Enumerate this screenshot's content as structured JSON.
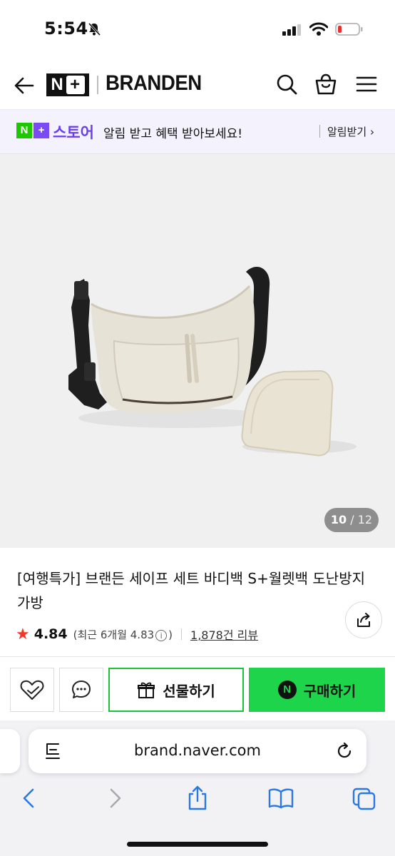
{
  "status_bar": {
    "time": "5:54"
  },
  "header": {
    "logo_text": "N+",
    "brand": "BRANDEN",
    "icons": [
      "back-arrow-icon",
      "search-icon",
      "shopping-bag-icon",
      "menu-icon"
    ]
  },
  "banner": {
    "logo_n": "N",
    "logo_plus": "+",
    "store_label": "스토어",
    "message": "알림 받고 혜택 받아보세요!",
    "action": "알림받기 ›"
  },
  "gallery": {
    "current": "10",
    "separator": "/",
    "total": "12"
  },
  "product": {
    "title": "[여행특가] 브랜든 세이프 세트 바디백 S+월렛백 도난방지 가방",
    "rating": "4.84",
    "recent_prefix": "(최근 6개월 4.83",
    "recent_suffix": ")",
    "info_glyph": "i",
    "reviews": "1,878건 리뷰"
  },
  "actions": {
    "gift_label": "선물하기",
    "buy_label": "구매하기",
    "buy_logo": "N"
  },
  "browser": {
    "url": "brand.naver.com"
  },
  "colors": {
    "accent_green": "#1ed44a",
    "store_purple": "#6b3df0",
    "banner_bg": "#f3f2fd",
    "star_red": "#f0392b"
  }
}
